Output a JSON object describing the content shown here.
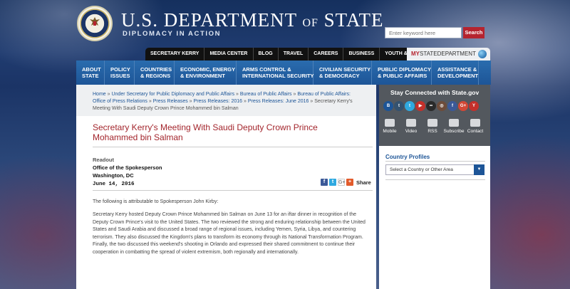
{
  "header": {
    "title_main": "U.S. DEPARTMENT",
    "title_of": "OF",
    "title_end": "STATE",
    "tagline": "DIPLOMACY IN ACTION",
    "search_placeholder": "Enter keyword here",
    "search_button": "Search"
  },
  "topnav": {
    "items": [
      {
        "label": "SECRETARY KERRY"
      },
      {
        "label": "MEDIA CENTER"
      },
      {
        "label": "BLOG"
      },
      {
        "label": "TRAVEL"
      },
      {
        "label": "CAREERS"
      },
      {
        "label": "BUSINESS"
      },
      {
        "label": "YOUTH & EDUCATION"
      }
    ],
    "mystate_prefix": "MY",
    "mystate_label": "STATEDEPARTMENT"
  },
  "mainnav": {
    "items": [
      {
        "line1": "ABOUT",
        "line2": "STATE"
      },
      {
        "line1": "POLICY",
        "line2": "ISSUES"
      },
      {
        "line1": "COUNTRIES",
        "line2": "& REGIONS"
      },
      {
        "line1": "ECONOMIC, ENERGY",
        "line2": "& ENVIRONMENT"
      },
      {
        "line1": "ARMS CONTROL &",
        "line2": "INTERNATIONAL SECURITY"
      },
      {
        "line1": "CIVILIAN SECURITY",
        "line2": "& DEMOCRACY"
      },
      {
        "line1": "PUBLIC DIPLOMACY",
        "line2": "& PUBLIC AFFAIRS"
      },
      {
        "line1": "ASSISTANCE &",
        "line2": "DEVELOPMENT"
      }
    ]
  },
  "breadcrumb": {
    "items": [
      "Home",
      "Under Secretary for Public Diplomacy and Public Affairs",
      "Bureau of Public Affairs",
      "Bureau of Public Affairs: Office of Press Relations",
      "Press Releases",
      "Press Releases: 2016",
      "Press Releases: June 2016"
    ],
    "separator": " » ",
    "current": "Secretary Kerry's Meeting With Saudi Deputy Crown Prince Mohammed bin Salman"
  },
  "article": {
    "title": "Secretary Kerry's Meeting With Saudi Deputy Crown Prince Mohammed bin Salman",
    "readout": "Readout",
    "office": "Office of the Spokesperson",
    "city": "Washington, DC",
    "date": "June 14, 2016",
    "share_label": "Share",
    "share_icons": [
      {
        "name": "facebook-icon",
        "glyph": "f",
        "color": "#3b5998"
      },
      {
        "name": "twitter-icon",
        "glyph": "t",
        "color": "#2fa9e0"
      },
      {
        "name": "google-plus-icon",
        "glyph": "G+",
        "color": "#ffffff"
      },
      {
        "name": "plus-share-icon",
        "glyph": "+",
        "color": "#e25b2b"
      }
    ],
    "para1": "The following is attributable to Spokesperson John Kirby:",
    "para2": "Secretary Kerry hosted Deputy Crown Prince Mohammed bin Salman on June 13 for an iftar dinner in recognition of the Deputy Crown Prince's visit to the United States. The two reviewed the strong and enduring relationship between the United States and Saudi Arabia and discussed a broad range of regional issues, including Yemen, Syria, Libya, and countering terrorism. They also discussed the Kingdom's plans to transform its economy through its National Transformation Program. Finally, the two discussed this weekend's shooting in Orlando and expressed their shared commitment to continue their cooperation in combatting the spread of violent extremism, both regionally and internationally."
  },
  "sidebar": {
    "stay_title": "Stay Connected with State.gov",
    "social_icons": [
      {
        "name": "blog-icon",
        "glyph": "B",
        "color": "#1d5597"
      },
      {
        "name": "tumblr-icon",
        "glyph": "t",
        "color": "#34526f"
      },
      {
        "name": "twitter-icon",
        "glyph": "t",
        "color": "#2fa9e0"
      },
      {
        "name": "youtube-icon",
        "glyph": "▶",
        "color": "#c4302b"
      },
      {
        "name": "flickr-icon",
        "glyph": "••",
        "color": "#2a2a2a"
      },
      {
        "name": "instagram-icon",
        "glyph": "◎",
        "color": "#6d4c3b"
      },
      {
        "name": "foursquare-icon",
        "glyph": "f",
        "color": "#3b5998"
      },
      {
        "name": "google-plus-icon",
        "glyph": "G+",
        "color": "#d34836"
      },
      {
        "name": "youtube-alt-icon",
        "glyph": "Y",
        "color": "#c4302b"
      }
    ],
    "utilities": [
      {
        "name": "mobile",
        "label": "Mobile"
      },
      {
        "name": "video",
        "label": "Video"
      },
      {
        "name": "rss",
        "label": "RSS"
      },
      {
        "name": "subscribe",
        "label": "Subscribe"
      },
      {
        "name": "contact",
        "label": "Contact"
      }
    ],
    "country_profiles_title": "Country Profiles",
    "country_select_value": "Select a Country or Other Area"
  },
  "colors": {
    "accent_red": "#b5242f",
    "nav_blue": "#1d5597",
    "title_red": "#a3252c"
  }
}
